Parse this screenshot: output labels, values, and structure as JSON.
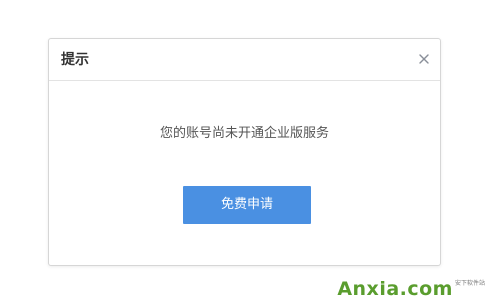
{
  "dialog": {
    "title": "提示",
    "close_icon": "close-icon",
    "message": "您的账号尚未开通企业版服务",
    "primary_button_label": "免费申请"
  },
  "watermark": {
    "brand": "Anxia.com",
    "sub": "安下软件站"
  },
  "colors": {
    "accent": "#4a90e2",
    "title_text": "#333333",
    "message_text": "#555555",
    "border": "#d6d6d6",
    "watermark_green": "#5a9d2e"
  }
}
